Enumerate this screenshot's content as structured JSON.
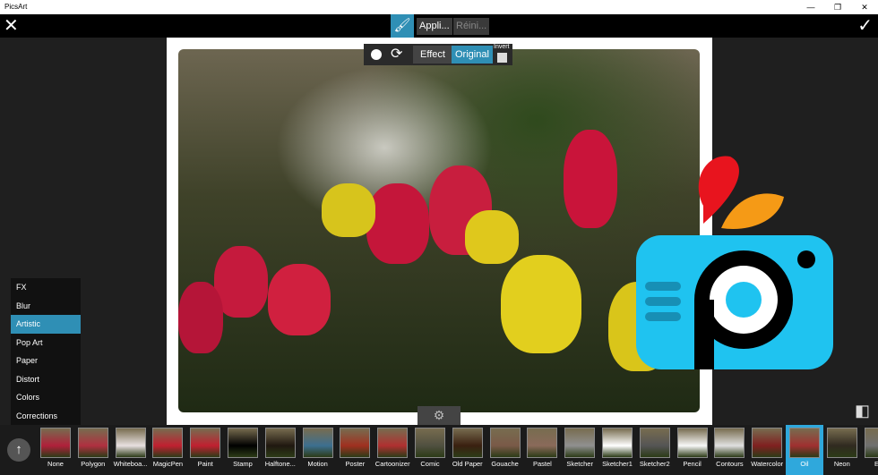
{
  "window": {
    "title": "PicsArt",
    "controls": [
      "—",
      "❐",
      "✕"
    ]
  },
  "toolbar": {
    "close": "✕",
    "apply": "Appli...",
    "reset": "Réini...",
    "confirm": "✓",
    "brush_icon": "brush-icon"
  },
  "brush_popup": {
    "effect": "Effect",
    "original": "Original",
    "invert": "Invert"
  },
  "categories": [
    {
      "label": "FX"
    },
    {
      "label": "Blur"
    },
    {
      "label": "Artistic",
      "selected": true
    },
    {
      "label": "Pop Art"
    },
    {
      "label": "Paper"
    },
    {
      "label": "Distort"
    },
    {
      "label": "Colors"
    },
    {
      "label": "Corrections"
    }
  ],
  "effects": [
    {
      "label": "None",
      "c": "#b0203a"
    },
    {
      "label": "Polygon",
      "c": "#b03040"
    },
    {
      "label": "Whiteboa...",
      "c": "#e8e0e0"
    },
    {
      "label": "MagicPen",
      "c": "#c02030"
    },
    {
      "label": "Paint",
      "c": "#c02030"
    },
    {
      "label": "Stamp",
      "c": "#000000"
    },
    {
      "label": "Halftone...",
      "c": "#201810"
    },
    {
      "label": "Motion",
      "c": "#3d6f90"
    },
    {
      "label": "Poster",
      "c": "#a03020"
    },
    {
      "label": "Cartoonizer",
      "c": "#b03030"
    },
    {
      "label": "Comic",
      "c": "#505040"
    },
    {
      "label": "Old Paper",
      "c": "#3a2010"
    },
    {
      "label": "Gouache",
      "c": "#7a5a48"
    },
    {
      "label": "Pastel",
      "c": "#8a6a5a"
    },
    {
      "label": "Sketcher",
      "c": "#909090"
    },
    {
      "label": "Sketcher1",
      "c": "#ffffff"
    },
    {
      "label": "Sketcher2",
      "c": "#555555"
    },
    {
      "label": "Pencil",
      "c": "#f8f8f8"
    },
    {
      "label": "Contours",
      "c": "#e0e0e0"
    },
    {
      "label": "Watercolor",
      "c": "#802020"
    },
    {
      "label": "Oil",
      "c": "#a03030",
      "selected": true
    },
    {
      "label": "Neon",
      "c": "#302a20"
    },
    {
      "label": "Em",
      "c": "#707070"
    }
  ],
  "colors": {
    "accent": "#2f8fb5",
    "selected_effect": "#2fa8dc",
    "logo_blue": "#1fc3f0"
  }
}
